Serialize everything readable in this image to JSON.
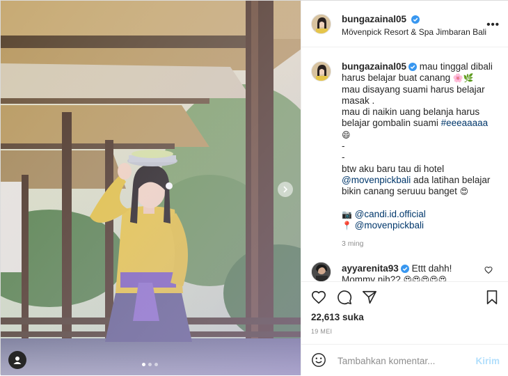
{
  "post": {
    "username": "bungazainal05",
    "location": "Mövenpick Resort & Spa Jimbaran Bali",
    "more_label": "•••",
    "caption_lines": [
      "mau tinggal dibali",
      "harus belajar buat canang",
      "mau disayang suami harus belajar",
      "masak .",
      "mau di naikin uang belanja harus",
      "belajar gombalin suami",
      "-",
      "-",
      "btw aku baru tau di hotel",
      "ada latihan belajar",
      "bikin canang seruuu banget"
    ],
    "caption_first_prefix": "mau tinggal dibali",
    "caption_tag_hashtag": "#eeeaaaaa",
    "caption_mention_hotel": "@movenpickbali",
    "credit_camera": "@candi.id.official",
    "credit_pin": "@movenpickbali",
    "emoji": {
      "flower": "🌸",
      "leaf": "🌿",
      "grin": "😄",
      "heart_eyes": "😍",
      "camera": "📷",
      "pin": "📍",
      "comment_faces": "😍😍😍😍😍"
    },
    "time_ago": "3 ming",
    "likes": "22,613 suka",
    "date": "19 MEI"
  },
  "comment": {
    "username": "ayyarenita93",
    "text_line1": "Ettt dahh!",
    "text_line2": "Mommy nih??"
  },
  "composer": {
    "placeholder": "Tambahkan komentar...",
    "post_label": "Kirim"
  },
  "icons": {
    "verified": "verified-badge-icon",
    "like": "heart-icon",
    "comment": "comment-bubble-icon",
    "share": "paper-plane-icon",
    "save": "bookmark-icon",
    "emoji": "smiley-icon",
    "user_tag": "user-tag-icon",
    "next": "chevron-right-icon"
  },
  "colors": {
    "verified_blue": "#3897f0",
    "link": "#00376b",
    "muted": "#8e8e8e",
    "post_button_disabled": "#b2dffc"
  },
  "carousel": {
    "count": 3,
    "active_index": 1
  }
}
